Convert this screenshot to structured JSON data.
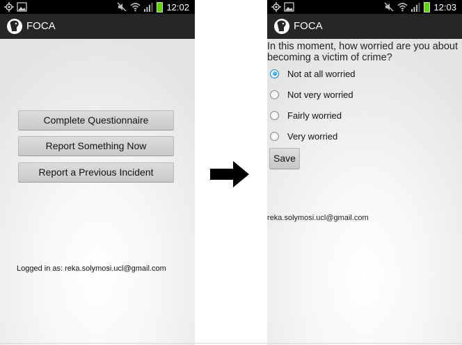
{
  "left_screen": {
    "status_time": "12:02",
    "app_title": "FOCA",
    "buttons": [
      "Complete Questionnaire",
      "Report Something Now",
      "Report a Previous Incident"
    ],
    "logged_in_text": "Logged in as: reka.solymosi.ucl@gmail.com"
  },
  "right_screen": {
    "status_time": "12:03",
    "app_title": "FOCA",
    "question": "In this moment, how worried are you about becoming a victim of crime?",
    "options": [
      "Not at all worried",
      "Not very worried",
      "Fairly worried",
      "Very worried"
    ],
    "selected_option": "Not at all worried",
    "save_label": "Save",
    "email": "reka.solymosi.ucl@gmail.com"
  },
  "icons": {
    "status_left": [
      "gps-icon",
      "image-notification-icon"
    ],
    "status_right": [
      "mute-icon",
      "wifi-icon",
      "signal-icon",
      "battery-icon"
    ],
    "transition": "right-arrow-icon"
  },
  "colors": {
    "status_bar": "#000000",
    "app_bar": "#262626",
    "radio_selected": "#1a8ee0",
    "battery": "#5fd000"
  }
}
